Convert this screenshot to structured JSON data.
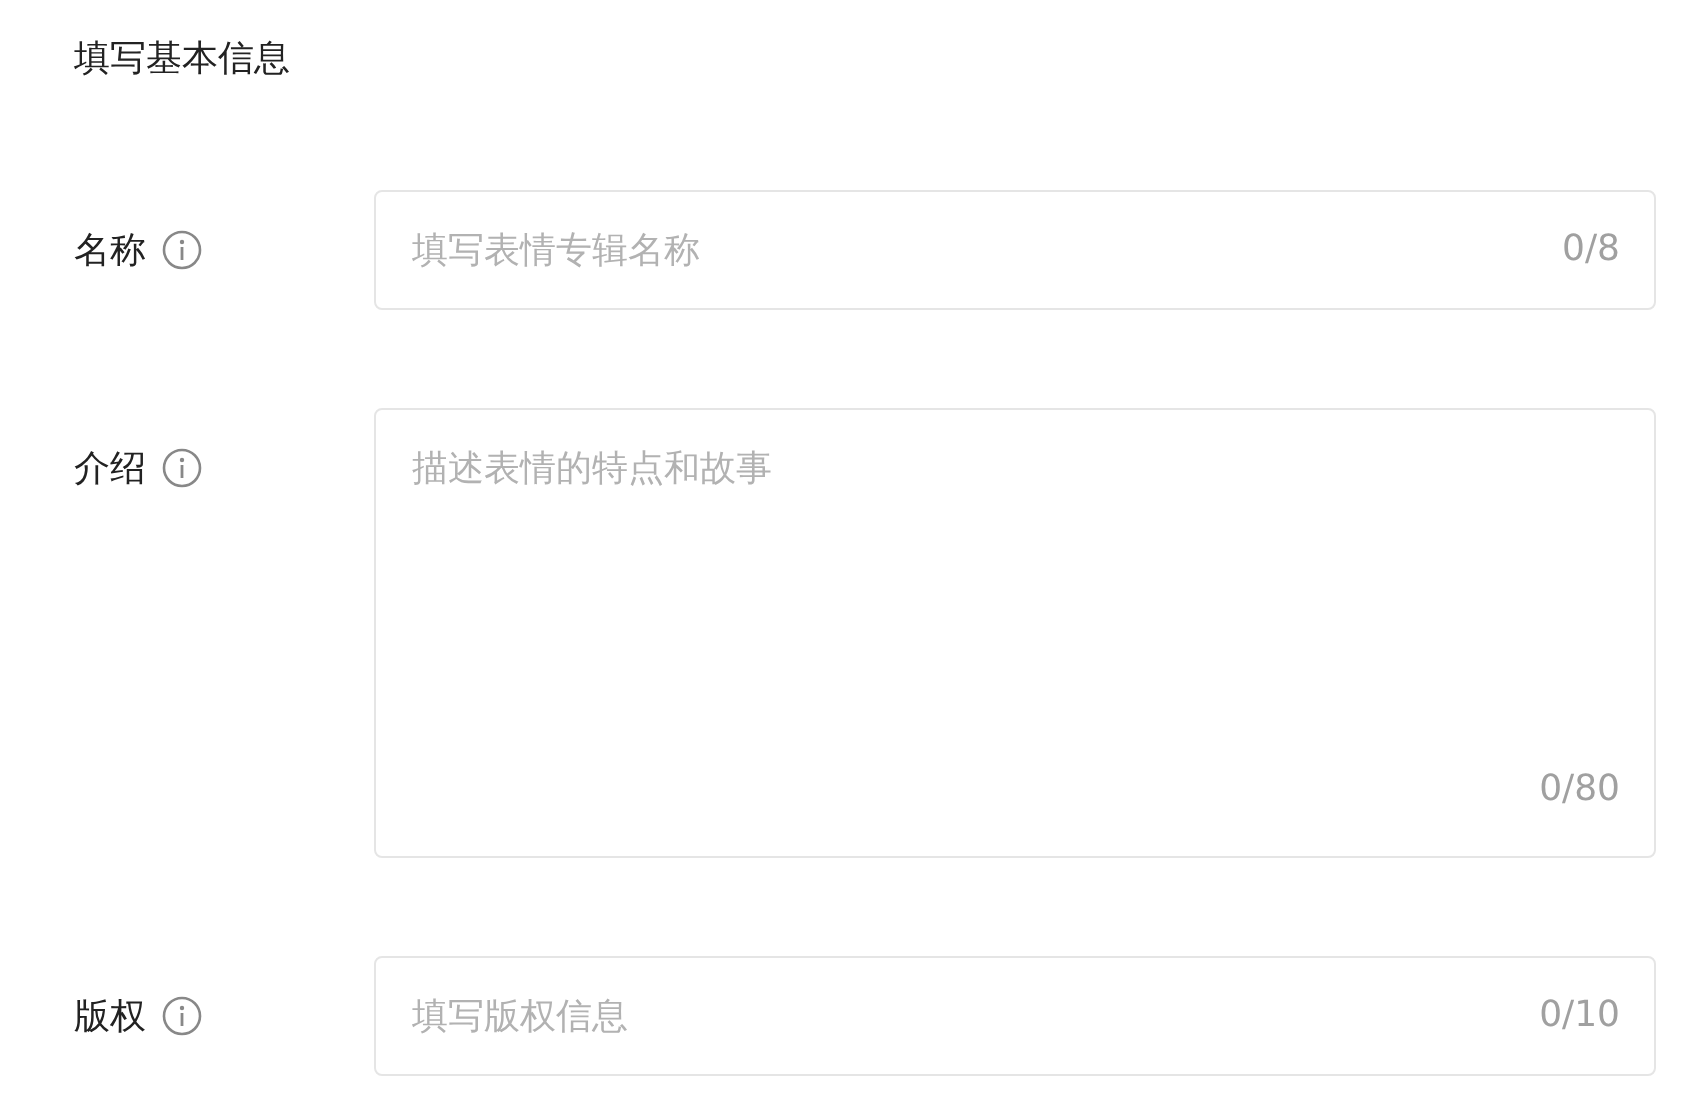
{
  "title": "填写基本信息",
  "fields": [
    {
      "label": "名称",
      "kind": "input",
      "placeholder": "填写表情专辑名称",
      "counter": "0/8"
    },
    {
      "label": "介绍",
      "kind": "textarea",
      "placeholder": "描述表情的特点和故事",
      "counter": "0/80"
    },
    {
      "label": "版权",
      "kind": "input",
      "placeholder": "填写版权信息",
      "counter": "0/10"
    }
  ]
}
